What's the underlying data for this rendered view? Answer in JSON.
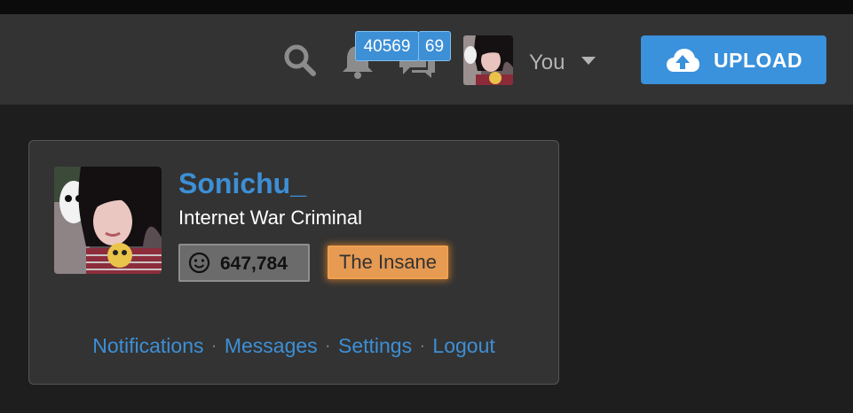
{
  "header": {
    "notifications_count": "40569",
    "messages_count": "69",
    "user_menu_label": "You",
    "upload_label": "UPLOAD",
    "icons": [
      "search-icon",
      "bell-icon",
      "chat-icon",
      "cloud-upload-icon",
      "chevron-down-icon"
    ]
  },
  "profile": {
    "username": "Sonichu_",
    "title": "Internet War Criminal",
    "reputation": "647,784",
    "rank": "The Insane"
  },
  "links": {
    "notifications": "Notifications",
    "messages": "Messages",
    "settings": "Settings",
    "logout": "Logout",
    "separator": "·"
  },
  "colors": {
    "accent": "#3d8fd6",
    "background": "#1e1e1e",
    "panel": "#333333",
    "rank_badge": "#e69a52",
    "upload_button": "#3a91dc"
  }
}
